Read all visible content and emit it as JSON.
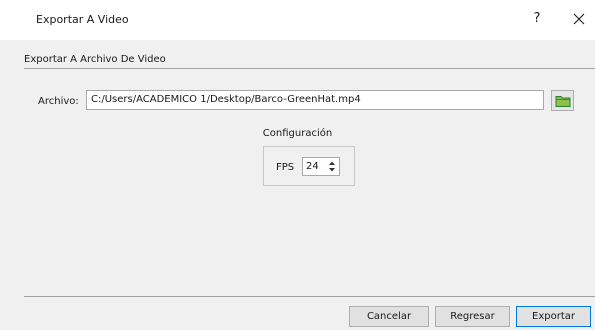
{
  "window": {
    "title": "Exportar A Video",
    "help_label": "?"
  },
  "section": {
    "title": "Exportar A Archivo De Video"
  },
  "file": {
    "label": "Archivo:",
    "value": "C:/Users/ACADEMICO 1/Desktop/Barco-GreenHat.mp4"
  },
  "config": {
    "title": "Configuración",
    "fps_label": "FPS",
    "fps_value": "24"
  },
  "buttons": {
    "cancel": "Cancelar",
    "back": "Regresar",
    "export": "Exportar"
  },
  "icons": {
    "browse": "folder-icon",
    "close": "close-icon",
    "spin": "spin-arrows-icon"
  },
  "colors": {
    "folder_green": "#4caf50",
    "accent_border": "#0078d7"
  }
}
